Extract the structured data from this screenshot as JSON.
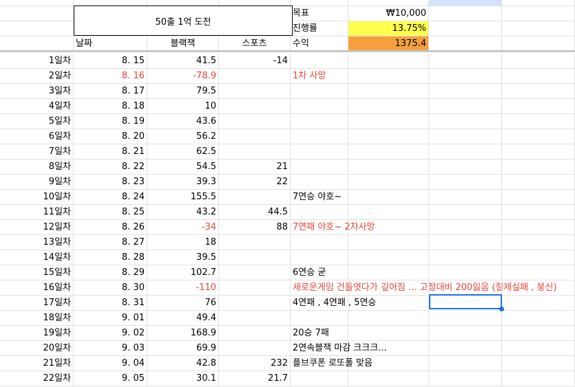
{
  "sheet": {
    "title": "50출 1억 도전",
    "headers": {
      "date": "날짜",
      "blackjack": "블랙잭",
      "sports": "스포츠"
    },
    "summary": {
      "goal_label": "목표",
      "goal_value": "₩10,000",
      "progress_label": "진행률",
      "progress_value": "13.75%",
      "profit_label": "수익",
      "profit_value": "1375.4",
      "colors": {
        "progress_bg": "#ffff4f",
        "profit_bg": "#f6a03d"
      }
    },
    "rows": [
      {
        "day": "1일차",
        "date": "8. 15",
        "blackjack": "41.5",
        "sports": "-14",
        "note": ""
      },
      {
        "day": "2일차",
        "date": "8. 16",
        "blackjack": "-78.9",
        "sports": "",
        "note": "1차  사망",
        "date_red": true,
        "bj_red": true,
        "note_red": true
      },
      {
        "day": "3일차",
        "date": "8. 17",
        "blackjack": "79.5",
        "sports": "",
        "note": ""
      },
      {
        "day": "4일차",
        "date": "8. 18",
        "blackjack": "10",
        "sports": "",
        "note": ""
      },
      {
        "day": "5일차",
        "date": "8. 19",
        "blackjack": "43.6",
        "sports": "",
        "note": ""
      },
      {
        "day": "6일차",
        "date": "8. 20",
        "blackjack": "56.2",
        "sports": "",
        "note": ""
      },
      {
        "day": "7일차",
        "date": "8. 21",
        "blackjack": "62.5",
        "sports": "",
        "note": ""
      },
      {
        "day": "8일차",
        "date": "8. 22",
        "blackjack": "54.5",
        "sports": "21",
        "note": ""
      },
      {
        "day": "9일차",
        "date": "8. 23",
        "blackjack": "39.3",
        "sports": "22",
        "note": ""
      },
      {
        "day": "10일차",
        "date": "8. 24",
        "blackjack": "155.5",
        "sports": "",
        "note": "7연승 야호~"
      },
      {
        "day": "11일차",
        "date": "8. 25",
        "blackjack": "43.2",
        "sports": "44.5",
        "note": ""
      },
      {
        "day": "12일차",
        "date": "8. 26",
        "blackjack": "-34",
        "sports": "88",
        "note": "7연패 야호~ 2차사망",
        "bj_red": true,
        "note_red": true
      },
      {
        "day": "13일차",
        "date": "8. 27",
        "blackjack": "18",
        "sports": "",
        "note": ""
      },
      {
        "day": "14일차",
        "date": "8. 28",
        "blackjack": "39.5",
        "sports": "",
        "note": ""
      },
      {
        "day": "15일차",
        "date": "8. 29",
        "blackjack": "102.7",
        "sports": "",
        "note": "6연승 굳"
      },
      {
        "day": "16일차",
        "date": "8. 30",
        "blackjack": "-110",
        "sports": "",
        "note": "새로운게임 건들엿다가 깊어짐 ... 고정대비 200잃음 (절제실패 , 붕신)",
        "bj_red": true,
        "note_red": true
      },
      {
        "day": "17일차",
        "date": "8. 31",
        "blackjack": "76",
        "sports": "",
        "note": "4연패 , 4연패 , 5연승"
      },
      {
        "day": "18일차",
        "date": "9. 01",
        "blackjack": "49.4",
        "sports": "",
        "note": ""
      },
      {
        "day": "19일차",
        "date": "9. 02",
        "blackjack": "168.9",
        "sports": "",
        "note": "20승 7패"
      },
      {
        "day": "20일차",
        "date": "9. 03",
        "blackjack": "69.9",
        "sports": "",
        "note": "2연속블잭 마감 크크크..."
      },
      {
        "day": "21일차",
        "date": "9. 04",
        "blackjack": "42.8",
        "sports": "232",
        "note": "플브쿠폰 로또폴 맞음"
      },
      {
        "day": "22일차",
        "date": "9. 05",
        "blackjack": "30.1",
        "sports": "21.7",
        "note": ""
      }
    ]
  }
}
